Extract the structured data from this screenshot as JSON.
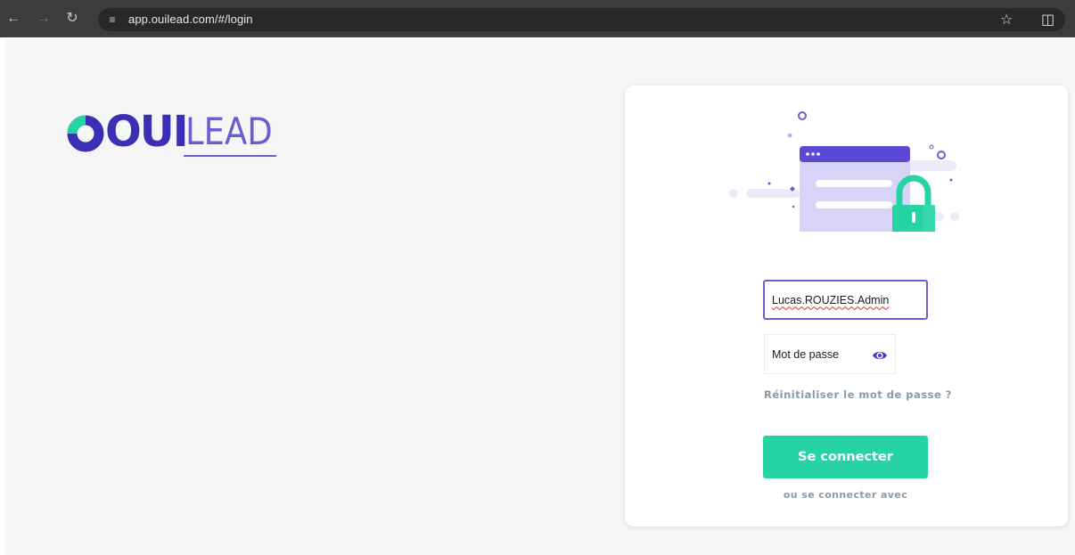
{
  "browser": {
    "url": "app.ouilead.com/#/login",
    "icons": [
      "back-arrow-icon",
      "forward-arrow-icon",
      "reload-icon",
      "site-info-icon",
      "bookmark-star-icon",
      "extensions-icon"
    ]
  },
  "logo": {
    "part1": "OUI",
    "part2": "LEAD",
    "colors": {
      "primary": "#3b2fb5",
      "accent": "#26d3a3",
      "secondary": "#6a5fd0"
    }
  },
  "login_form": {
    "username_value": "Lucas.ROUZIES.Admin",
    "password_placeholder": "Mot de passe",
    "reset_password_link": "Réinitialiser le mot de passe ?",
    "submit_label": "Se connecter",
    "alt_login_text": "ou se connecter avec"
  },
  "colors": {
    "button": "#26d3a3",
    "input_focus_border": "#6a5fd0",
    "muted_text": "#8a9aa6",
    "page_background": "#f6f6f6"
  }
}
